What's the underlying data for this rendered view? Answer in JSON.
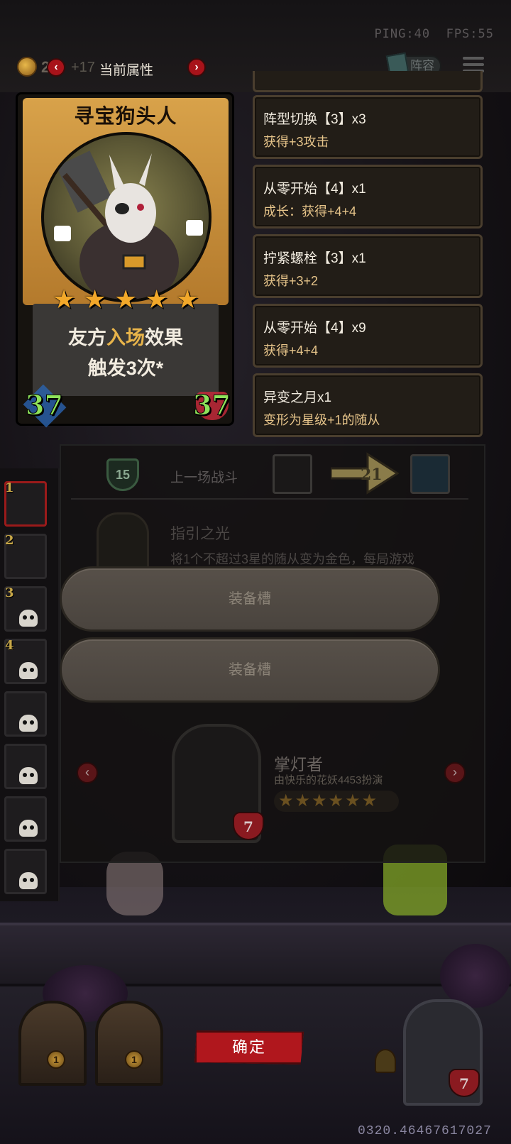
{
  "hud": {
    "ping": "PING:40",
    "fps": "FPS:55",
    "gold": "2",
    "gold_income": "+17",
    "attr_title": "当前属性",
    "lineup_label": "阵容"
  },
  "card": {
    "name": "寻宝狗头人",
    "stars": 5,
    "effect_line1_pre": "友方",
    "effect_line1_hl": "入场",
    "effect_line1_post": "效果",
    "effect_line2": "触发3次*",
    "attack": "37",
    "health": "37"
  },
  "buffs": [
    {
      "name": "阵型切换【3】x3",
      "desc": "获得+3攻击"
    },
    {
      "name": "从零开始【4】x1",
      "desc": "成长：获得+4+4"
    },
    {
      "name": "拧紧螺栓【3】x1",
      "desc": "获得+3+2"
    },
    {
      "name": "从零开始【4】x9",
      "desc": "获得+4+4"
    },
    {
      "name": "异变之月x1",
      "desc": "变形为星级+1的随从"
    }
  ],
  "battle": {
    "shield_value": "15",
    "prev_battle_label": "上一场战斗",
    "result_value": "21"
  },
  "guide": {
    "title": "指引之光",
    "desc": "将1个不超过3星的随从变为金色，每局游戏"
  },
  "slots": {
    "slot1": "装备槽",
    "slot2": "装备槽"
  },
  "player": {
    "name": "掌灯者",
    "by": "由快乐的花妖4453扮演",
    "stars": 6,
    "health": "7"
  },
  "ranks": [
    "1",
    "2",
    "3",
    "4"
  ],
  "bottom": {
    "confirm": "确定",
    "id": "0320.46467617027",
    "door_left_value": "1",
    "door_right_value": "1",
    "hero_health": "7"
  },
  "colors": {
    "card_gold": "#d8a24a",
    "star": "#f2a82a",
    "stat_green": "#8ee25a",
    "confirm_red": "#b0171d",
    "highlight": "#e8b44a"
  }
}
